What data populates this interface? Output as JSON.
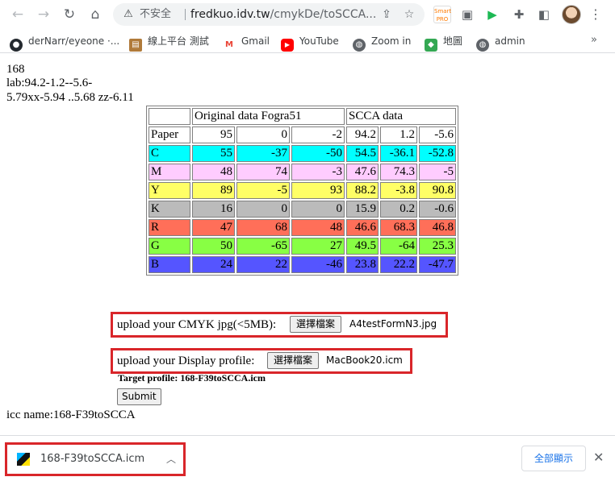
{
  "browser": {
    "security_label": "不安全",
    "url_host": "fredkuo.idv.tw",
    "url_path": "/cmykDe/toSCCA...",
    "extensions": [
      {
        "name": "smart-extension",
        "text": "Smart",
        "color": "#ff8a00"
      },
      {
        "name": "cast-extension",
        "text": "▣",
        "color": "#f2f2f2"
      },
      {
        "name": "play-extension",
        "text": "▶",
        "color": "#1db954"
      }
    ]
  },
  "bookmarks": [
    {
      "label": "derNarr/eyeone ·...",
      "icon": "github-icon"
    },
    {
      "label": "線上平台 測試",
      "icon": "image-icon"
    },
    {
      "label": "Gmail",
      "icon": "gmail-icon"
    },
    {
      "label": "YouTube",
      "icon": "youtube-icon"
    },
    {
      "label": "Zoom in",
      "icon": "globe-icon"
    },
    {
      "label": "地圖",
      "icon": "maps-icon"
    },
    {
      "label": "admin",
      "icon": "globe-icon"
    }
  ],
  "page": {
    "line1": "168",
    "line2": "lab:94.2-1.2--5.6-",
    "line3": "5.79xx-5.94 ..5.68 zz-6.11",
    "table": {
      "header_original": "Original data Fogra51",
      "header_scca": "SCCA data",
      "rows": [
        {
          "label": "Paper",
          "color": "#ffffff",
          "values": [
            "95",
            "0",
            "-2",
            "94.2",
            "1.2",
            "-5.6"
          ]
        },
        {
          "label": "C",
          "color": "#00ffff",
          "values": [
            "55",
            "-37",
            "-50",
            "54.5",
            "-36.1",
            "-52.8"
          ]
        },
        {
          "label": "M",
          "color": "#ffccff",
          "values": [
            "48",
            "74",
            "-3",
            "47.6",
            "74.3",
            "-5"
          ]
        },
        {
          "label": "Y",
          "color": "#ffff66",
          "values": [
            "89",
            "-5",
            "93",
            "88.2",
            "-3.8",
            "90.8"
          ]
        },
        {
          "label": "K",
          "color": "#bbbbbb",
          "values": [
            "16",
            "0",
            "0",
            "15.9",
            "0.2",
            "-0.6"
          ]
        },
        {
          "label": "R",
          "color": "#ff6f59",
          "values": [
            "47",
            "68",
            "48",
            "46.6",
            "68.3",
            "46.8"
          ]
        },
        {
          "label": "G",
          "color": "#88ff44",
          "values": [
            "50",
            "-65",
            "27",
            "49.5",
            "-64",
            "25.3"
          ]
        },
        {
          "label": "B",
          "color": "#5555ff",
          "values": [
            "24",
            "22",
            "-46",
            "23.8",
            "22.2",
            "-47.7"
          ]
        }
      ]
    },
    "upload_cmyk_label": "upload your CMYK jpg(<5MB):",
    "upload_cmyk_button": "選擇檔案",
    "upload_cmyk_file": "A4testFormN3.jpg",
    "upload_display_label": "upload your Display profile:",
    "upload_display_button": "選擇檔案",
    "upload_display_file": "MacBook20.icm",
    "target_profile": "Target profile: 168-F39toSCCA.icm",
    "submit_label": "Submit",
    "icc_name": "icc name:168-F39toSCCA"
  },
  "downloads": {
    "file_name": "168-F39toSCCA.icm",
    "show_all_label": "全部顯示"
  }
}
